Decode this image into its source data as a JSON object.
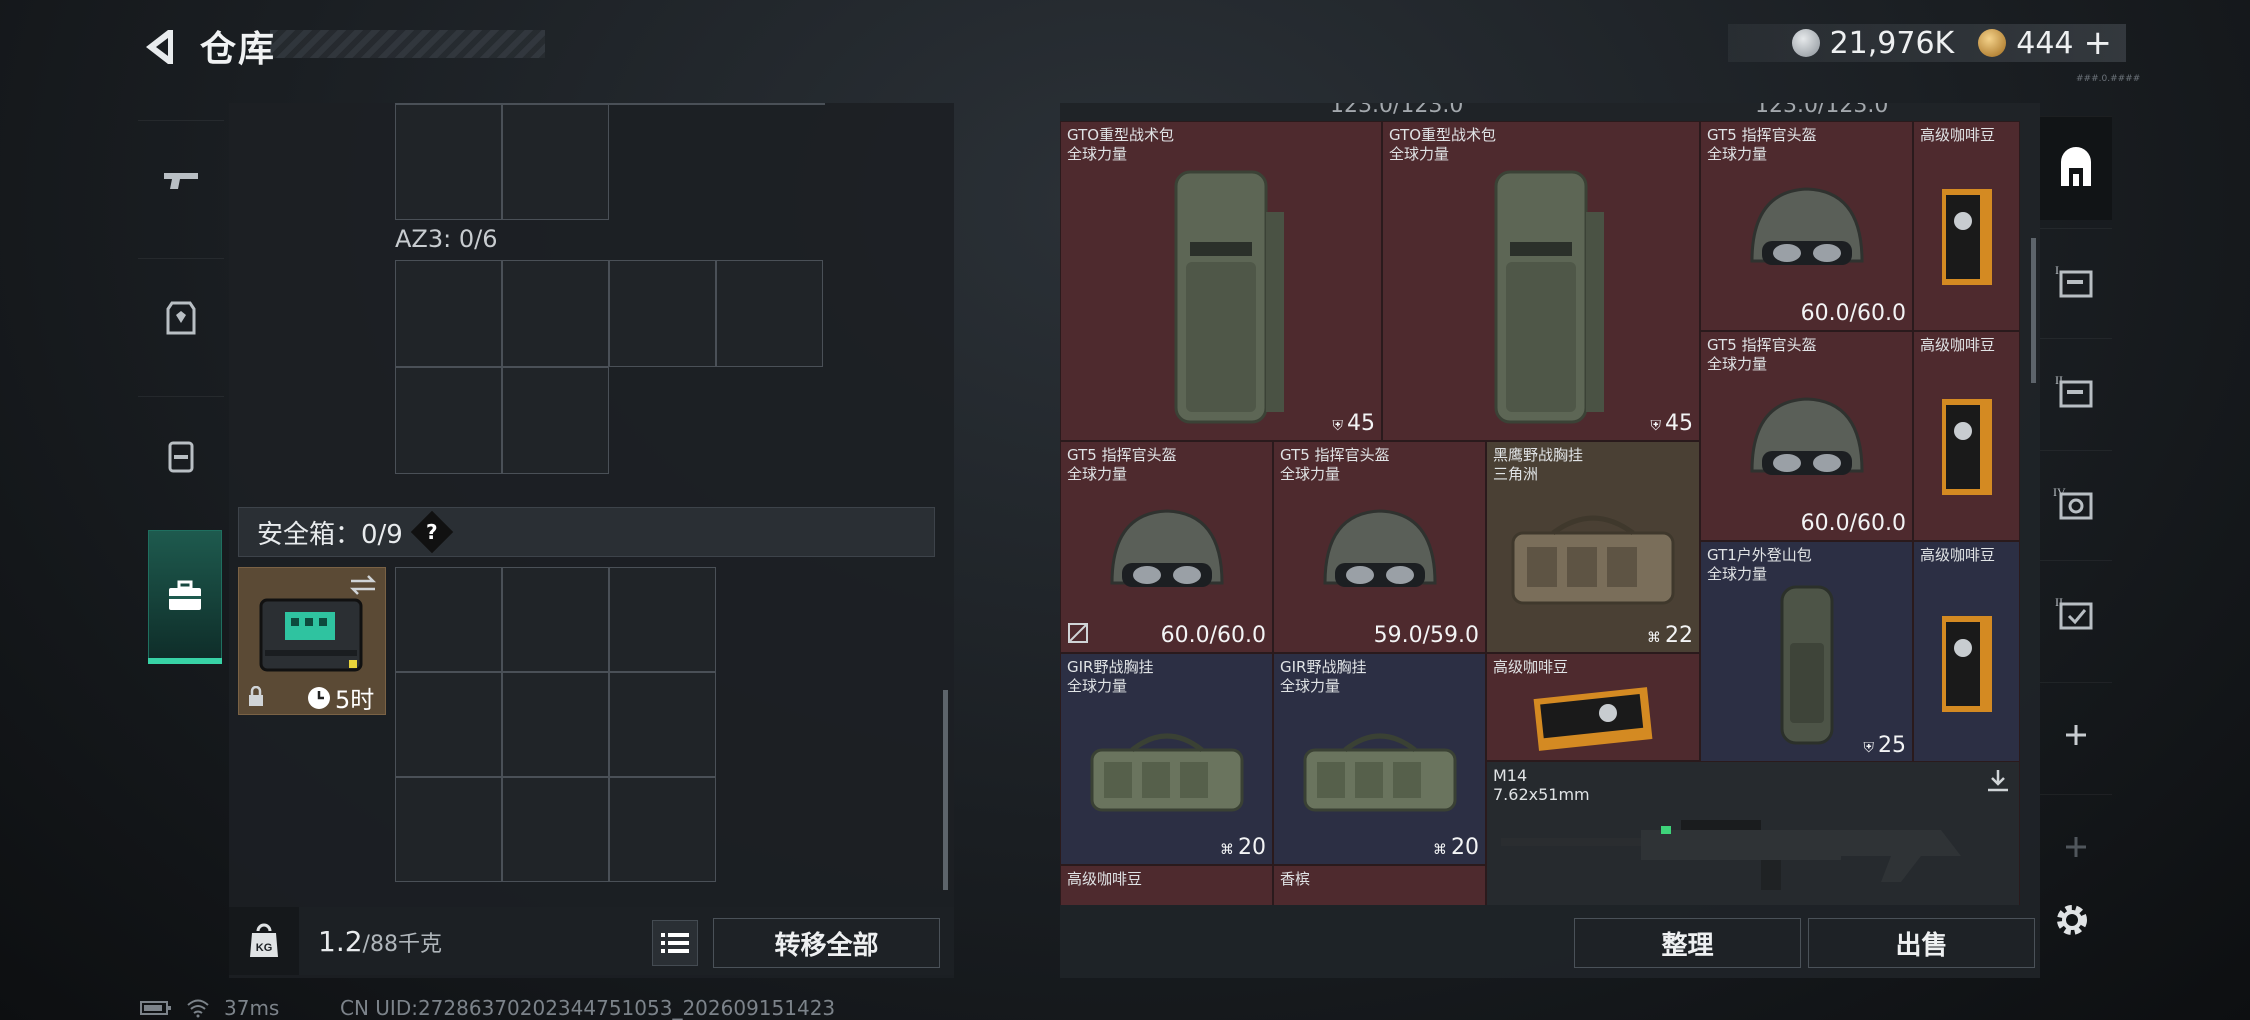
{
  "header": {
    "title": "仓库",
    "silver": "21,976K",
    "gold": "444",
    "plus": "+"
  },
  "left": {
    "az3_label": "AZ3: 0/6",
    "safe_label": "安全箱：0/9",
    "safe_help": "?",
    "safebox_timer": "5时",
    "weight_value": "1.2",
    "weight_unit": "/88千克",
    "transfer_label": "转移全部",
    "kg_label": "KG"
  },
  "items": [
    {
      "name": "GTO重型战术包",
      "sub": "全球力量",
      "value": "45",
      "badge": "bag",
      "color": "red"
    },
    {
      "name": "GTO重型战术包",
      "sub": "全球力量",
      "value": "45",
      "badge": "bag",
      "color": "red"
    },
    {
      "name": "GT5 指挥官头盔",
      "sub": "全球力量",
      "value": "60.0/60.0",
      "color": "red"
    },
    {
      "name": "高级咖啡豆",
      "sub": "",
      "value": "",
      "color": "red"
    },
    {
      "name": "GT5 指挥官头盔",
      "sub": "全球力量",
      "value": "60.0/60.0",
      "color": "red"
    },
    {
      "name": "高级咖啡豆",
      "sub": "",
      "value": "",
      "color": "red"
    },
    {
      "name": "GT5 指挥官头盔",
      "sub": "全球力量",
      "value": "60.0/60.0",
      "color": "red"
    },
    {
      "name": "GT5 指挥官头盔",
      "sub": "全球力量",
      "value": "59.0/59.0",
      "color": "red"
    },
    {
      "name": "黑鹰野战胸挂",
      "sub": "三角洲",
      "value": "22",
      "color": "gold"
    },
    {
      "name": "GT1户外登山包",
      "sub": "全球力量",
      "value": "25",
      "color": "blue"
    },
    {
      "name": "高级咖啡豆",
      "sub": "",
      "value": "",
      "color": "blue"
    },
    {
      "name": "GIR野战胸挂",
      "sub": "全球力量",
      "value": "20",
      "color": "blue"
    },
    {
      "name": "GIR野战胸挂",
      "sub": "全球力量",
      "value": "20",
      "color": "blue"
    },
    {
      "name": "高级咖啡豆",
      "sub": "",
      "value": "",
      "color": "red"
    },
    {
      "name": "M14",
      "sub": "7.62x51mm",
      "value": "",
      "color": "dark"
    },
    {
      "name": "高级咖啡豆",
      "sub": "",
      "value": "",
      "color": "red"
    },
    {
      "name": "香槟",
      "sub": "",
      "value": "",
      "color": "red"
    }
  ],
  "top_partial": "123.0/123.0",
  "right": {
    "sort_label": "整理",
    "sell_label": "出售"
  },
  "status": {
    "ping": "37ms",
    "uid": "CN UID:27286370202344751053_202609151423"
  },
  "version": "###.0.####"
}
